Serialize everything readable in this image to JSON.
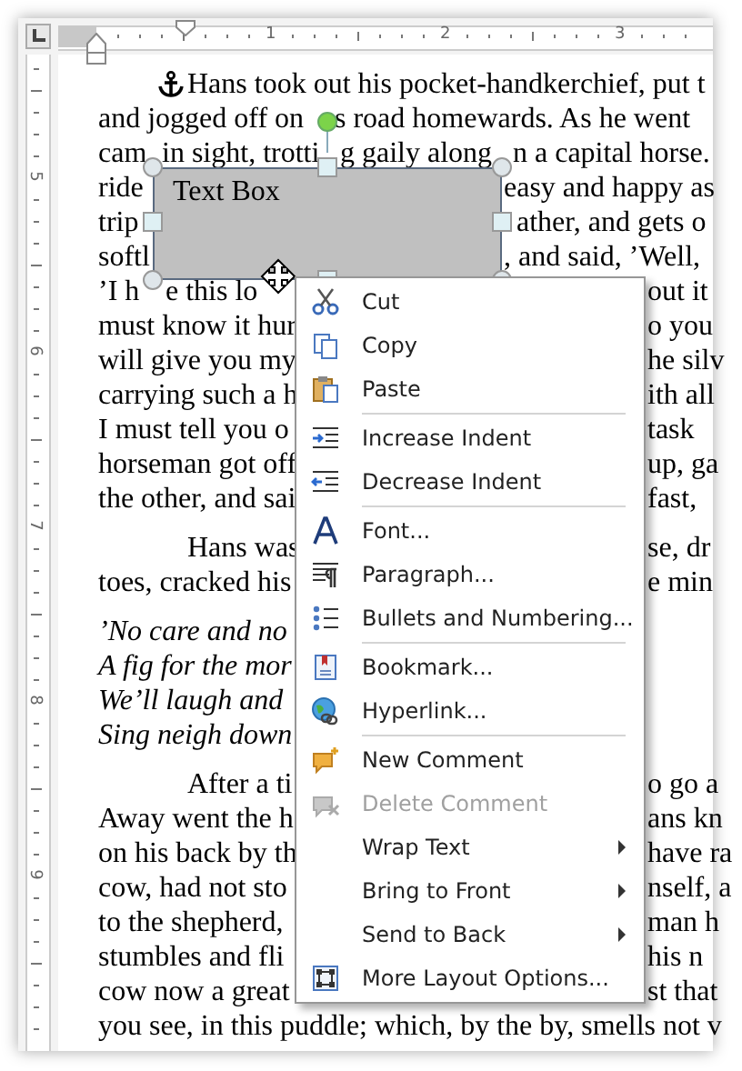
{
  "rulers": {
    "top_numbers": [
      "1",
      "2",
      "3"
    ],
    "left_numbers": [
      "5",
      "6",
      "7",
      "8",
      "9"
    ]
  },
  "document": {
    "paragraphs": [
      {
        "kind": "body",
        "anchor": true,
        "lines": [
          {
            "segments": [
              "Hans took out his pocket-handkerchief, put t"
            ]
          },
          {
            "segments": [
              "and jogged off on",
              "s road homewards. As he went"
            ]
          },
          {
            "segments": [
              "cam",
              "in sight, trotti",
              "g gaily along",
              "n a capital horse."
            ]
          },
          {
            "segments": [
              "ride",
              "easy and happy as"
            ]
          },
          {
            "segments": [
              "trip",
              "ather, and gets o"
            ]
          },
          {
            "segments": [
              "softl",
              ", and said, ’Well,"
            ]
          },
          {
            "segments": [
              "’I h",
              "e this lo",
              "out it"
            ]
          },
          {
            "segments": [
              "must know it hur",
              "o you"
            ]
          },
          {
            "segments": [
              "will give you my",
              "he silv"
            ]
          },
          {
            "segments": [
              "carrying such a h",
              "ith all"
            ]
          },
          {
            "segments": [
              "I must tell you o",
              "task"
            ]
          },
          {
            "segments": [
              "horseman got off",
              "up, ga"
            ]
          },
          {
            "segments": [
              "the other, and sai",
              "fast,"
            ]
          }
        ]
      },
      {
        "kind": "body",
        "lines": [
          {
            "segments": [
              "Hans was",
              "se, dr"
            ]
          },
          {
            "segments": [
              "toes, cracked his",
              "e min"
            ]
          }
        ]
      },
      {
        "kind": "verse",
        "lines": [
          {
            "segments": [
              "’No care and no"
            ]
          },
          {
            "segments": [
              "A fig for the mor"
            ]
          },
          {
            "segments": [
              "We’ll laugh and"
            ]
          },
          {
            "segments": [
              "Sing neigh down"
            ]
          }
        ]
      },
      {
        "kind": "body",
        "lines": [
          {
            "segments": [
              "After a ti",
              "o go a"
            ]
          },
          {
            "segments": [
              "Away went the h",
              "ans kn"
            ]
          },
          {
            "segments": [
              "on his back by th",
              "have ra"
            ]
          },
          {
            "segments": [
              "cow, had not sto",
              "nself, a"
            ]
          },
          {
            "segments": [
              "to the shepherd,",
              "man h"
            ]
          },
          {
            "segments": [
              "stumbles and fli",
              "his n"
            ]
          },
          {
            "segments": [
              "cow now a great",
              "st that"
            ]
          },
          {
            "segments": [
              "you see, in this puddle; which, by the by, smells not v"
            ]
          }
        ]
      }
    ]
  },
  "text_box": {
    "text": "Text Box"
  },
  "context_menu": {
    "items": [
      {
        "kind": "command",
        "label": "Cut",
        "disabled": false,
        "submenu": false
      },
      {
        "kind": "command",
        "label": "Copy",
        "disabled": false,
        "submenu": false
      },
      {
        "kind": "command",
        "label": "Paste",
        "disabled": false,
        "submenu": false
      },
      {
        "kind": "separator"
      },
      {
        "kind": "command",
        "label": "Increase Indent",
        "disabled": false,
        "submenu": false
      },
      {
        "kind": "command",
        "label": "Decrease Indent",
        "disabled": false,
        "submenu": false
      },
      {
        "kind": "separator"
      },
      {
        "kind": "command",
        "label": "Font...",
        "disabled": false,
        "submenu": false
      },
      {
        "kind": "command",
        "label": "Paragraph...",
        "disabled": false,
        "submenu": false
      },
      {
        "kind": "command",
        "label": "Bullets and Numbering...",
        "disabled": false,
        "submenu": false
      },
      {
        "kind": "separator"
      },
      {
        "kind": "command",
        "label": "Bookmark...",
        "disabled": false,
        "submenu": false
      },
      {
        "kind": "command",
        "label": "Hyperlink...",
        "disabled": false,
        "submenu": false
      },
      {
        "kind": "separator"
      },
      {
        "kind": "command",
        "label": "New Comment",
        "disabled": false,
        "submenu": false
      },
      {
        "kind": "command",
        "label": "Delete Comment",
        "disabled": true,
        "submenu": false
      },
      {
        "kind": "command",
        "label": "Wrap Text",
        "disabled": false,
        "submenu": true
      },
      {
        "kind": "command",
        "label": "Bring to Front",
        "disabled": false,
        "submenu": true
      },
      {
        "kind": "command",
        "label": "Send to Back",
        "disabled": false,
        "submenu": true
      },
      {
        "kind": "command",
        "label": "More Layout Options...",
        "disabled": false,
        "submenu": false
      }
    ]
  }
}
